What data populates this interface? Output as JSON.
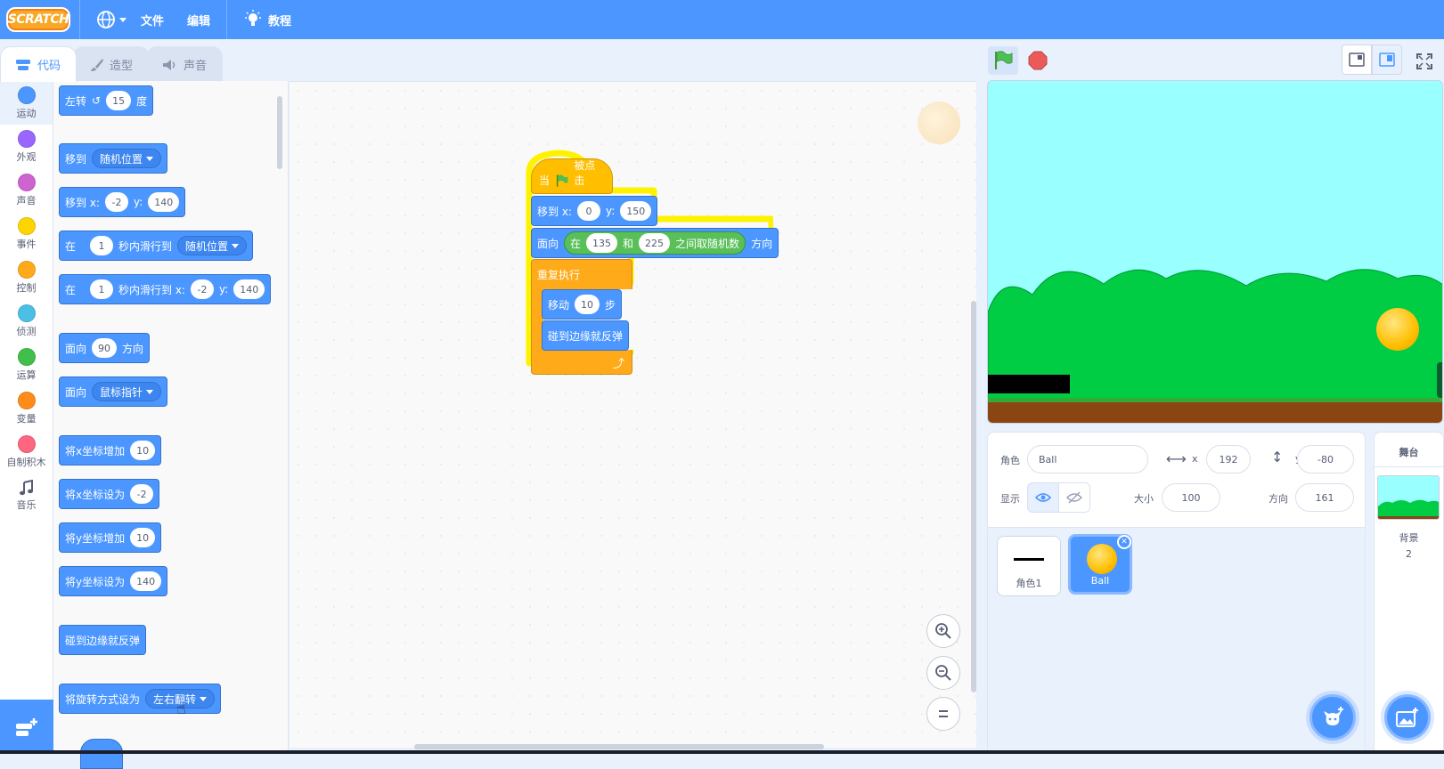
{
  "menubar": {
    "logo": "SCRATCH",
    "file": "文件",
    "edit": "编辑",
    "tutorials": "教程"
  },
  "tabs": [
    {
      "label": "代码"
    },
    {
      "label": "造型"
    },
    {
      "label": "声音"
    }
  ],
  "categories": [
    {
      "label": "运动",
      "color": "#4c97ff"
    },
    {
      "label": "外观",
      "color": "#9966ff"
    },
    {
      "label": "声音",
      "color": "#cf63cf"
    },
    {
      "label": "事件",
      "color": "#ffd500"
    },
    {
      "label": "控制",
      "color": "#ffab19"
    },
    {
      "label": "侦测",
      "color": "#4cbfe6"
    },
    {
      "label": "运算",
      "color": "#40bf4a"
    },
    {
      "label": "变量",
      "color": "#ff8c1a"
    },
    {
      "label": "自制积木",
      "color": "#ff6680"
    },
    {
      "label": "音乐",
      "color": "#0fbd8c"
    }
  ],
  "palette": {
    "turn_left": {
      "pre": "左转",
      "value": "15",
      "post": "度"
    },
    "goto": {
      "pre": "移到",
      "menu": "随机位置"
    },
    "goto_xy": {
      "pre": "移到 x:",
      "x": "-2",
      "ylabel": "y:",
      "y": "140"
    },
    "glide": {
      "pre": "在",
      "secs": "1",
      "mid": "秒内滑行到",
      "menu": "随机位置"
    },
    "glide_xy": {
      "pre": "在",
      "secs": "1",
      "mid": "秒内滑行到 x:",
      "x": "-2",
      "ylabel": "y:",
      "y": "140"
    },
    "point_dir": {
      "pre": "面向",
      "value": "90",
      "post": "方向"
    },
    "point_towards": {
      "pre": "面向",
      "menu": "鼠标指针"
    },
    "change_x": {
      "pre": "将x坐标增加",
      "value": "10"
    },
    "set_x": {
      "pre": "将x坐标设为",
      "value": "-2"
    },
    "change_y": {
      "pre": "将y坐标增加",
      "value": "10"
    },
    "set_y": {
      "pre": "将y坐标设为",
      "value": "140"
    },
    "bounce": {
      "label": "碰到边缘就反弹"
    },
    "rotation_style": {
      "pre": "将旋转方式设为",
      "menu": "左右翻转"
    }
  },
  "script": {
    "hat": {
      "pre": "当",
      "post": "被点击"
    },
    "goto_xy": {
      "pre": "移到 x:",
      "x": "0",
      "ylabel": "y:",
      "y": "150"
    },
    "point": {
      "pre": "面向",
      "rand_pre": "在",
      "from": "135",
      "and": "和",
      "to": "225",
      "rand_post": "之间取随机数",
      "post": "方向"
    },
    "forever": {
      "label": "重复执行"
    },
    "move": {
      "pre": "移动",
      "value": "10",
      "post": "步"
    },
    "bounce": {
      "label": "碰到边缘就反弹"
    }
  },
  "sprite_info": {
    "sprite_label": "角色",
    "sprite_name": "Ball",
    "x_label": "x",
    "x": "192",
    "y_label": "y",
    "y": "-80",
    "show_label": "显示",
    "size_label": "大小",
    "size": "100",
    "direction_label": "方向",
    "direction": "161"
  },
  "sprites": [
    {
      "name": "角色1"
    },
    {
      "name": "Ball"
    }
  ],
  "stage_panel": {
    "title": "舞台",
    "backdrop_label": "背景",
    "backdrop_count": "2"
  },
  "colors": {
    "accent": "#4c97ff",
    "motion": "#4c97ff",
    "control": "#ffab19",
    "operators": "#59c059",
    "events": "#ffbf00",
    "sky": "#99ffff",
    "hills": "#00cc44",
    "ground": "#8b4513"
  }
}
